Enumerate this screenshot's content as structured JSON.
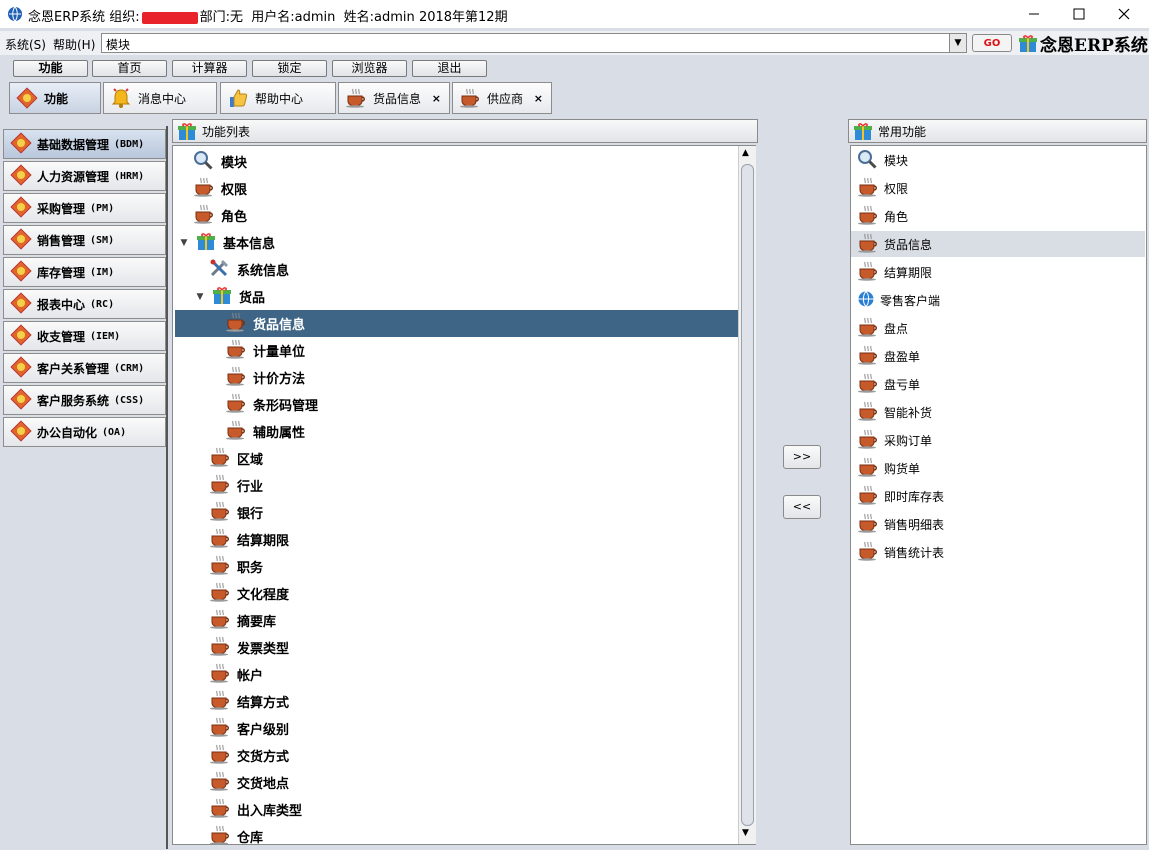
{
  "window": {
    "title_app": "念恩ERP系统",
    "title_org_label": "组织:",
    "title_dept": "部门:无",
    "title_user": "用户名:admin",
    "title_name": "姓名:admin",
    "title_period": "2018年第12期"
  },
  "menubar": {
    "system": "系统(S)",
    "help": "帮助(H)",
    "address_value": "模块",
    "go_label": "GO",
    "brand": "念恩ERP系统"
  },
  "toolbar": [
    "功能",
    "首页",
    "计算器",
    "锁定",
    "浏览器",
    "退出"
  ],
  "tabs": [
    {
      "label": "功能",
      "icon": "fortune-icon",
      "closable": false
    },
    {
      "label": "消息中心",
      "icon": "bell-icon",
      "closable": false
    },
    {
      "label": "帮助中心",
      "icon": "thumbs-up-icon",
      "closable": false
    },
    {
      "label": "货品信息",
      "icon": "coffee-cup-icon",
      "closable": true
    },
    {
      "label": "供应商",
      "icon": "coffee-cup-icon",
      "closable": true
    }
  ],
  "close_glyph": "×",
  "modules": [
    {
      "name": "基础数据管理",
      "code": "(BDM)"
    },
    {
      "name": "人力资源管理",
      "code": "(HRM)"
    },
    {
      "name": "采购管理",
      "code": "(PM)"
    },
    {
      "name": "销售管理",
      "code": "(SM)"
    },
    {
      "name": "库存管理",
      "code": "(IM)"
    },
    {
      "name": "报表中心",
      "code": "(RC)"
    },
    {
      "name": "收支管理",
      "code": "(IEM)"
    },
    {
      "name": "客户关系管理",
      "code": "(CRM)"
    },
    {
      "name": "客户服务系统",
      "code": "(CSS)"
    },
    {
      "name": "办公自动化",
      "code": "(OA)"
    }
  ],
  "function_list": {
    "title": "功能列表",
    "items": [
      {
        "label": "模块",
        "icon": "magnifier-icon",
        "level": 0
      },
      {
        "label": "权限",
        "icon": "coffee-cup-icon",
        "level": 0
      },
      {
        "label": "角色",
        "icon": "coffee-cup-icon",
        "level": 0
      },
      {
        "label": "基本信息",
        "icon": "gift-box-icon",
        "level": 0,
        "expander": "▼"
      },
      {
        "label": "系统信息",
        "icon": "tools-icon",
        "level": 1
      },
      {
        "label": "货品",
        "icon": "gift-box-icon",
        "level": 1,
        "expander": "▼"
      },
      {
        "label": "货品信息",
        "icon": "coffee-cup-icon",
        "level": 2,
        "selected": true
      },
      {
        "label": "计量单位",
        "icon": "coffee-cup-icon",
        "level": 2
      },
      {
        "label": "计价方法",
        "icon": "coffee-cup-icon",
        "level": 2
      },
      {
        "label": "条形码管理",
        "icon": "coffee-cup-icon",
        "level": 2
      },
      {
        "label": "辅助属性",
        "icon": "coffee-cup-icon",
        "level": 2
      },
      {
        "label": "区域",
        "icon": "coffee-cup-icon",
        "level": 1
      },
      {
        "label": "行业",
        "icon": "coffee-cup-icon",
        "level": 1
      },
      {
        "label": "银行",
        "icon": "coffee-cup-icon",
        "level": 1
      },
      {
        "label": "结算期限",
        "icon": "coffee-cup-icon",
        "level": 1
      },
      {
        "label": "职务",
        "icon": "coffee-cup-icon",
        "level": 1
      },
      {
        "label": "文化程度",
        "icon": "coffee-cup-icon",
        "level": 1
      },
      {
        "label": "摘要库",
        "icon": "coffee-cup-icon",
        "level": 1
      },
      {
        "label": "发票类型",
        "icon": "coffee-cup-icon",
        "level": 1
      },
      {
        "label": "帐户",
        "icon": "coffee-cup-icon",
        "level": 1
      },
      {
        "label": "结算方式",
        "icon": "coffee-cup-icon",
        "level": 1
      },
      {
        "label": "客户级别",
        "icon": "coffee-cup-icon",
        "level": 1
      },
      {
        "label": "交货方式",
        "icon": "coffee-cup-icon",
        "level": 1
      },
      {
        "label": "交货地点",
        "icon": "coffee-cup-icon",
        "level": 1
      },
      {
        "label": "出入库类型",
        "icon": "coffee-cup-icon",
        "level": 1
      },
      {
        "label": "仓库",
        "icon": "coffee-cup-icon",
        "level": 1
      }
    ]
  },
  "transfer": {
    "add": ">>",
    "remove": "<<"
  },
  "favorites": {
    "title": "常用功能",
    "items": [
      {
        "label": "模块",
        "icon": "magnifier-icon"
      },
      {
        "label": "权限",
        "icon": "coffee-cup-icon"
      },
      {
        "label": "角色",
        "icon": "coffee-cup-icon"
      },
      {
        "label": "货品信息",
        "icon": "coffee-cup-icon",
        "selected": true
      },
      {
        "label": "结算期限",
        "icon": "coffee-cup-icon"
      },
      {
        "label": "零售客户端",
        "icon": "globe-icon"
      },
      {
        "label": "盘点",
        "icon": "coffee-cup-icon"
      },
      {
        "label": "盘盈单",
        "icon": "coffee-cup-icon"
      },
      {
        "label": "盘亏单",
        "icon": "coffee-cup-icon"
      },
      {
        "label": "智能补货",
        "icon": "coffee-cup-icon"
      },
      {
        "label": "采购订单",
        "icon": "coffee-cup-icon"
      },
      {
        "label": "购货单",
        "icon": "coffee-cup-icon"
      },
      {
        "label": "即时库存表",
        "icon": "coffee-cup-icon"
      },
      {
        "label": "销售明细表",
        "icon": "coffee-cup-icon"
      },
      {
        "label": "销售统计表",
        "icon": "coffee-cup-icon"
      }
    ]
  },
  "colors": {
    "selection": "#3e6586",
    "accent_red": "#d11111"
  }
}
